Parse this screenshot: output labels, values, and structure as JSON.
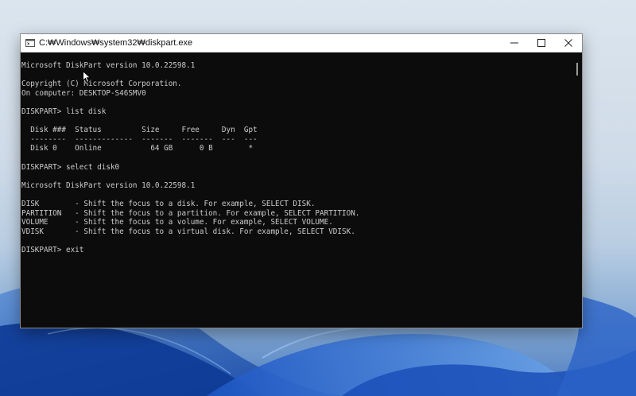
{
  "window": {
    "title": "C:₩Windows₩system32₩diskpart.exe",
    "icon": "console-icon",
    "controls": {
      "minimize_icon": "minimize-icon",
      "maximize_icon": "maximize-icon",
      "close_icon": "close-icon"
    }
  },
  "console": {
    "lines": [
      "Microsoft DiskPart version 10.0.22598.1",
      "",
      "Copyright (C) Microsoft Corporation.",
      "On computer: DESKTOP-S46SMV0",
      "",
      "DISKPART> list disk",
      "",
      "  Disk ###  Status         Size     Free     Dyn  Gpt",
      "  --------  -------------  -------  -------  ---  ---",
      "  Disk 0    Online           64 GB      0 B        *",
      "",
      "DISKPART> select disk0",
      "",
      "Microsoft DiskPart version 10.0.22598.1",
      "",
      "DISK        - Shift the focus to a disk. For example, SELECT DISK.",
      "PARTITION   - Shift the focus to a partition. For example, SELECT PARTITION.",
      "VOLUME      - Shift the focus to a volume. For example, SELECT VOLUME.",
      "VDISK       - Shift the focus to a virtual disk. For example, SELECT VDISK.",
      "",
      "DISKPART> exit"
    ],
    "text_color": "#cccccc",
    "background": "#0c0c0c"
  },
  "colors": {
    "wallpaper_accent": "#1f5fc7",
    "titlebar_bg": "#ffffff"
  }
}
